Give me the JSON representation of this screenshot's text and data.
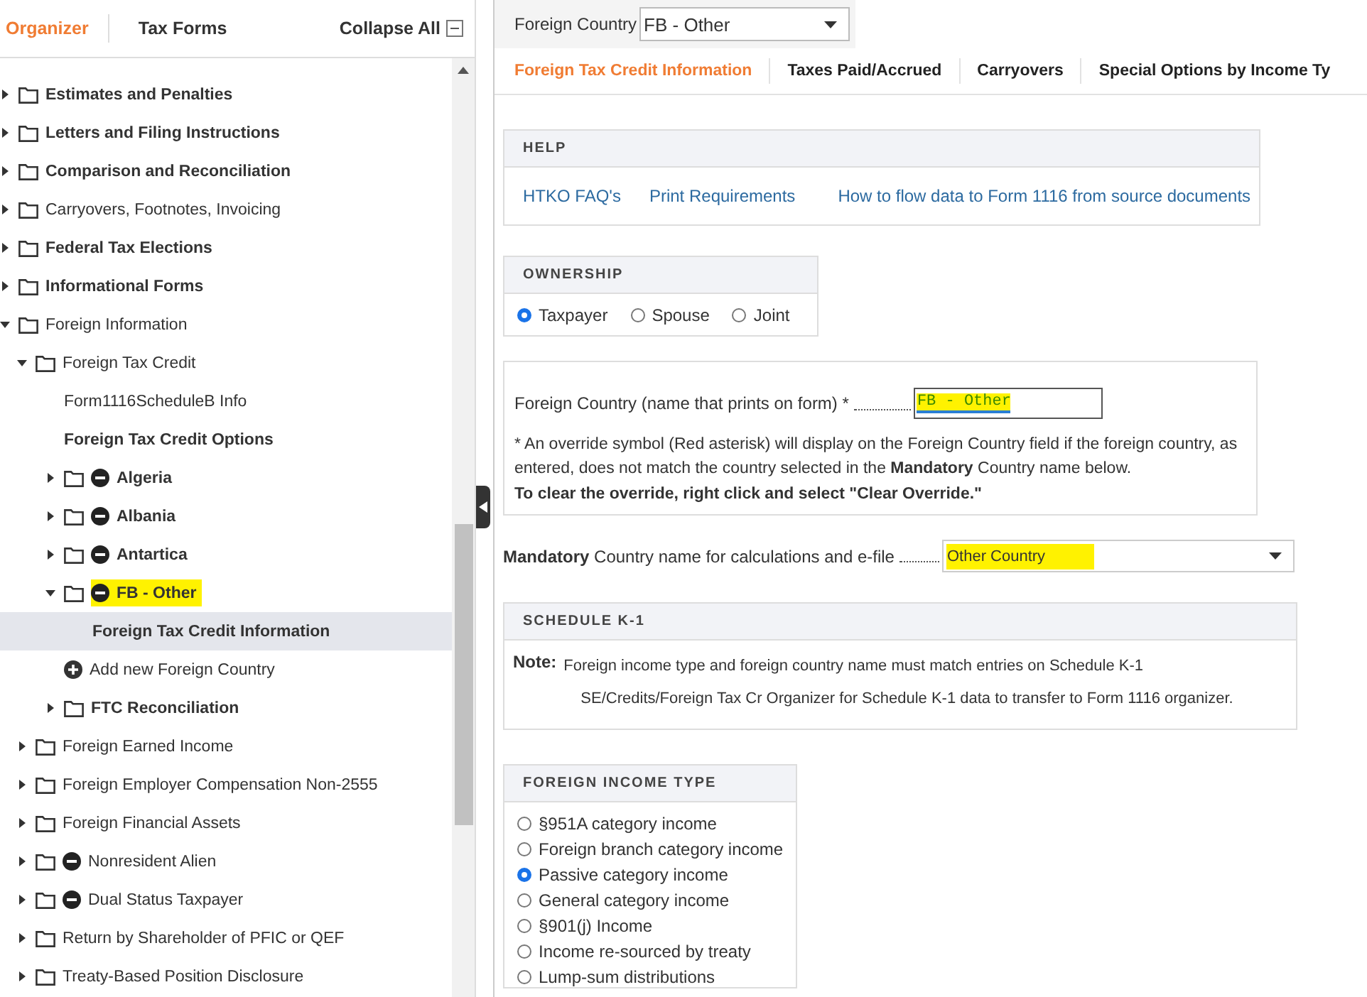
{
  "sidebar": {
    "tabs": [
      {
        "label": "Organizer",
        "selected": true
      },
      {
        "label": "Tax Forms",
        "selected": false
      }
    ],
    "collapse_all": "Collapse All",
    "tree": [
      {
        "kind": "folder",
        "label": "Estimates and Penalties",
        "bold": true,
        "expanded": false
      },
      {
        "kind": "folder",
        "label": "Letters and Filing Instructions",
        "bold": true,
        "expanded": false
      },
      {
        "kind": "folder",
        "label": "Comparison and Reconciliation",
        "bold": true,
        "expanded": false
      },
      {
        "kind": "folder",
        "label": "Carryovers, Footnotes, Invoicing",
        "bold": false,
        "expanded": false
      },
      {
        "kind": "folder",
        "label": "Federal Tax Elections",
        "bold": true,
        "expanded": false
      },
      {
        "kind": "folder",
        "label": "Informational Forms",
        "bold": true,
        "expanded": false
      },
      {
        "kind": "folder",
        "label": "Foreign Information",
        "bold": false,
        "expanded": true,
        "children": [
          {
            "kind": "folder",
            "label": "Foreign Tax Credit",
            "bold": false,
            "expanded": true,
            "children": [
              {
                "kind": "page",
                "label": "Form1116ScheduleB Info",
                "bold": false
              },
              {
                "kind": "page",
                "label": "Foreign Tax Credit Options",
                "bold": true
              },
              {
                "kind": "folder",
                "label": "Algeria",
                "bold": true,
                "marked": true,
                "expanded": false
              },
              {
                "kind": "folder",
                "label": "Albania",
                "bold": true,
                "marked": true,
                "expanded": false
              },
              {
                "kind": "folder",
                "label": "Antartica",
                "bold": true,
                "marked": true,
                "expanded": false
              },
              {
                "kind": "folder",
                "label": "FB - Other",
                "bold": true,
                "marked": true,
                "highlighted": true,
                "expanded": true,
                "children": [
                  {
                    "kind": "page",
                    "label": "Foreign Tax Credit Information",
                    "bold": true,
                    "selected": true
                  }
                ]
              },
              {
                "kind": "add",
                "label": "Add new Foreign Country",
                "bold": false
              },
              {
                "kind": "folder",
                "label": "FTC Reconciliation",
                "bold": true,
                "expanded": false
              }
            ]
          },
          {
            "kind": "folder",
            "label": "Foreign Earned Income",
            "bold": false,
            "expanded": false
          },
          {
            "kind": "folder",
            "label": "Foreign Employer Compensation Non-2555",
            "bold": false,
            "expanded": false
          },
          {
            "kind": "folder",
            "label": "Foreign Financial Assets",
            "bold": false,
            "expanded": false
          },
          {
            "kind": "folder",
            "label": "Nonresident Alien",
            "bold": false,
            "marked": true,
            "expanded": false
          },
          {
            "kind": "folder",
            "label": "Dual Status Taxpayer",
            "bold": false,
            "marked": true,
            "expanded": false
          },
          {
            "kind": "folder",
            "label": "Return by Shareholder of PFIC or QEF",
            "bold": false,
            "expanded": false
          },
          {
            "kind": "folder",
            "label": "Treaty-Based Position Disclosure",
            "bold": false,
            "expanded": false
          }
        ]
      }
    ]
  },
  "country_bar": {
    "label": "Foreign Country",
    "value": "FB - Other"
  },
  "tabs": [
    {
      "label": "Foreign Tax Credit Information",
      "selected": true
    },
    {
      "label": "Taxes Paid/Accrued",
      "selected": false
    },
    {
      "label": "Carryovers",
      "selected": false
    },
    {
      "label": "Special Options by Income Ty",
      "selected": false
    }
  ],
  "help": {
    "title": "HELP",
    "links": [
      "HTKO FAQ's",
      "Print Requirements",
      "How to flow data to Form 1116 from source documents"
    ]
  },
  "ownership": {
    "title": "OWNERSHIP",
    "options": [
      {
        "label": "Taxpayer",
        "selected": true
      },
      {
        "label": "Spouse",
        "selected": false
      },
      {
        "label": "Joint",
        "selected": false
      }
    ]
  },
  "country_name": {
    "label": "Foreign Country  (name that prints on form) *",
    "value": "FB - Other",
    "highlighted": true,
    "note": "* An override symbol (Red asterisk) will display on the Foreign Country field if the foreign country, as entered, does not match the country selected in the **Mandatory** Country name below.",
    "instruction": "To clear the override, right click and select \"Clear Override.\""
  },
  "mandatory": {
    "label": "**Mandatory** Country name for calculations and e-file",
    "value": "Other Country",
    "highlighted": true
  },
  "schedule_k1": {
    "title": "SCHEDULE K-1",
    "note_label": "Note:",
    "lines": [
      "Foreign income type and foreign country name must match entries on Schedule K-1",
      "SE/Credits/Foreign Tax Cr Organizer for Schedule K-1 data to transfer to Form 1116 organizer."
    ]
  },
  "income_type": {
    "title": "FOREIGN INCOME TYPE",
    "options": [
      {
        "label": "§951A category income",
        "selected": false
      },
      {
        "label": "Foreign branch category income",
        "selected": false
      },
      {
        "label": "Passive category income",
        "selected": true
      },
      {
        "label": "General category income",
        "selected": false
      },
      {
        "label": "§901(j) Income",
        "selected": false
      },
      {
        "label": "Income re-sourced by treaty",
        "selected": false
      },
      {
        "label": "Lump-sum distributions",
        "selected": false
      }
    ]
  }
}
